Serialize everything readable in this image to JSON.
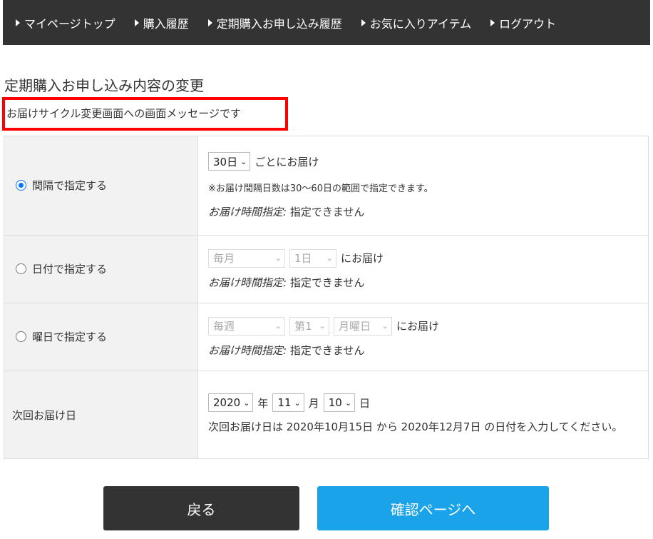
{
  "nav": [
    {
      "label": "マイページトップ"
    },
    {
      "label": "購入履歴"
    },
    {
      "label": "定期購入お申し込み履歴"
    },
    {
      "label": "お気に入りアイテム"
    },
    {
      "label": "ログアウト"
    }
  ],
  "page_title": "定期購入お申し込み内容の変更",
  "screen_message": "お届けサイクル変更画面への画面メッセージです",
  "interval": {
    "label": "間隔で指定する",
    "selected": true,
    "days": "30日",
    "suffix": "ごとにお届け",
    "note": "※お届け間隔日数は30〜60日の範囲で指定できます。",
    "time_label": "お届け時間指定:",
    "time_value": "指定できません"
  },
  "date": {
    "label": "日付で指定する",
    "selected": false,
    "month": "毎月",
    "day": "1日",
    "suffix": "にお届け",
    "time_label": "お届け時間指定:",
    "time_value": "指定できません"
  },
  "weekday": {
    "label": "曜日で指定する",
    "selected": false,
    "freq": "毎週",
    "week": "第1",
    "dow": "月曜日",
    "suffix": "にお届け",
    "time_label": "お届け時間指定:",
    "time_value": "指定できません"
  },
  "next": {
    "label": "次回お届け日",
    "year": "2020",
    "year_unit": "年",
    "month": "11",
    "month_unit": "月",
    "day": "10",
    "day_unit": "日",
    "note": "次回お届け日は 2020年10月15日 から 2020年12月7日 の日付を入力してください。"
  },
  "buttons": {
    "back": "戻る",
    "confirm": "確認ページへ"
  },
  "colors": {
    "nav_bg": "#333333",
    "back_bg": "#333333",
    "confirm_bg": "#1aa3e8",
    "highlight": "#ff0000"
  }
}
